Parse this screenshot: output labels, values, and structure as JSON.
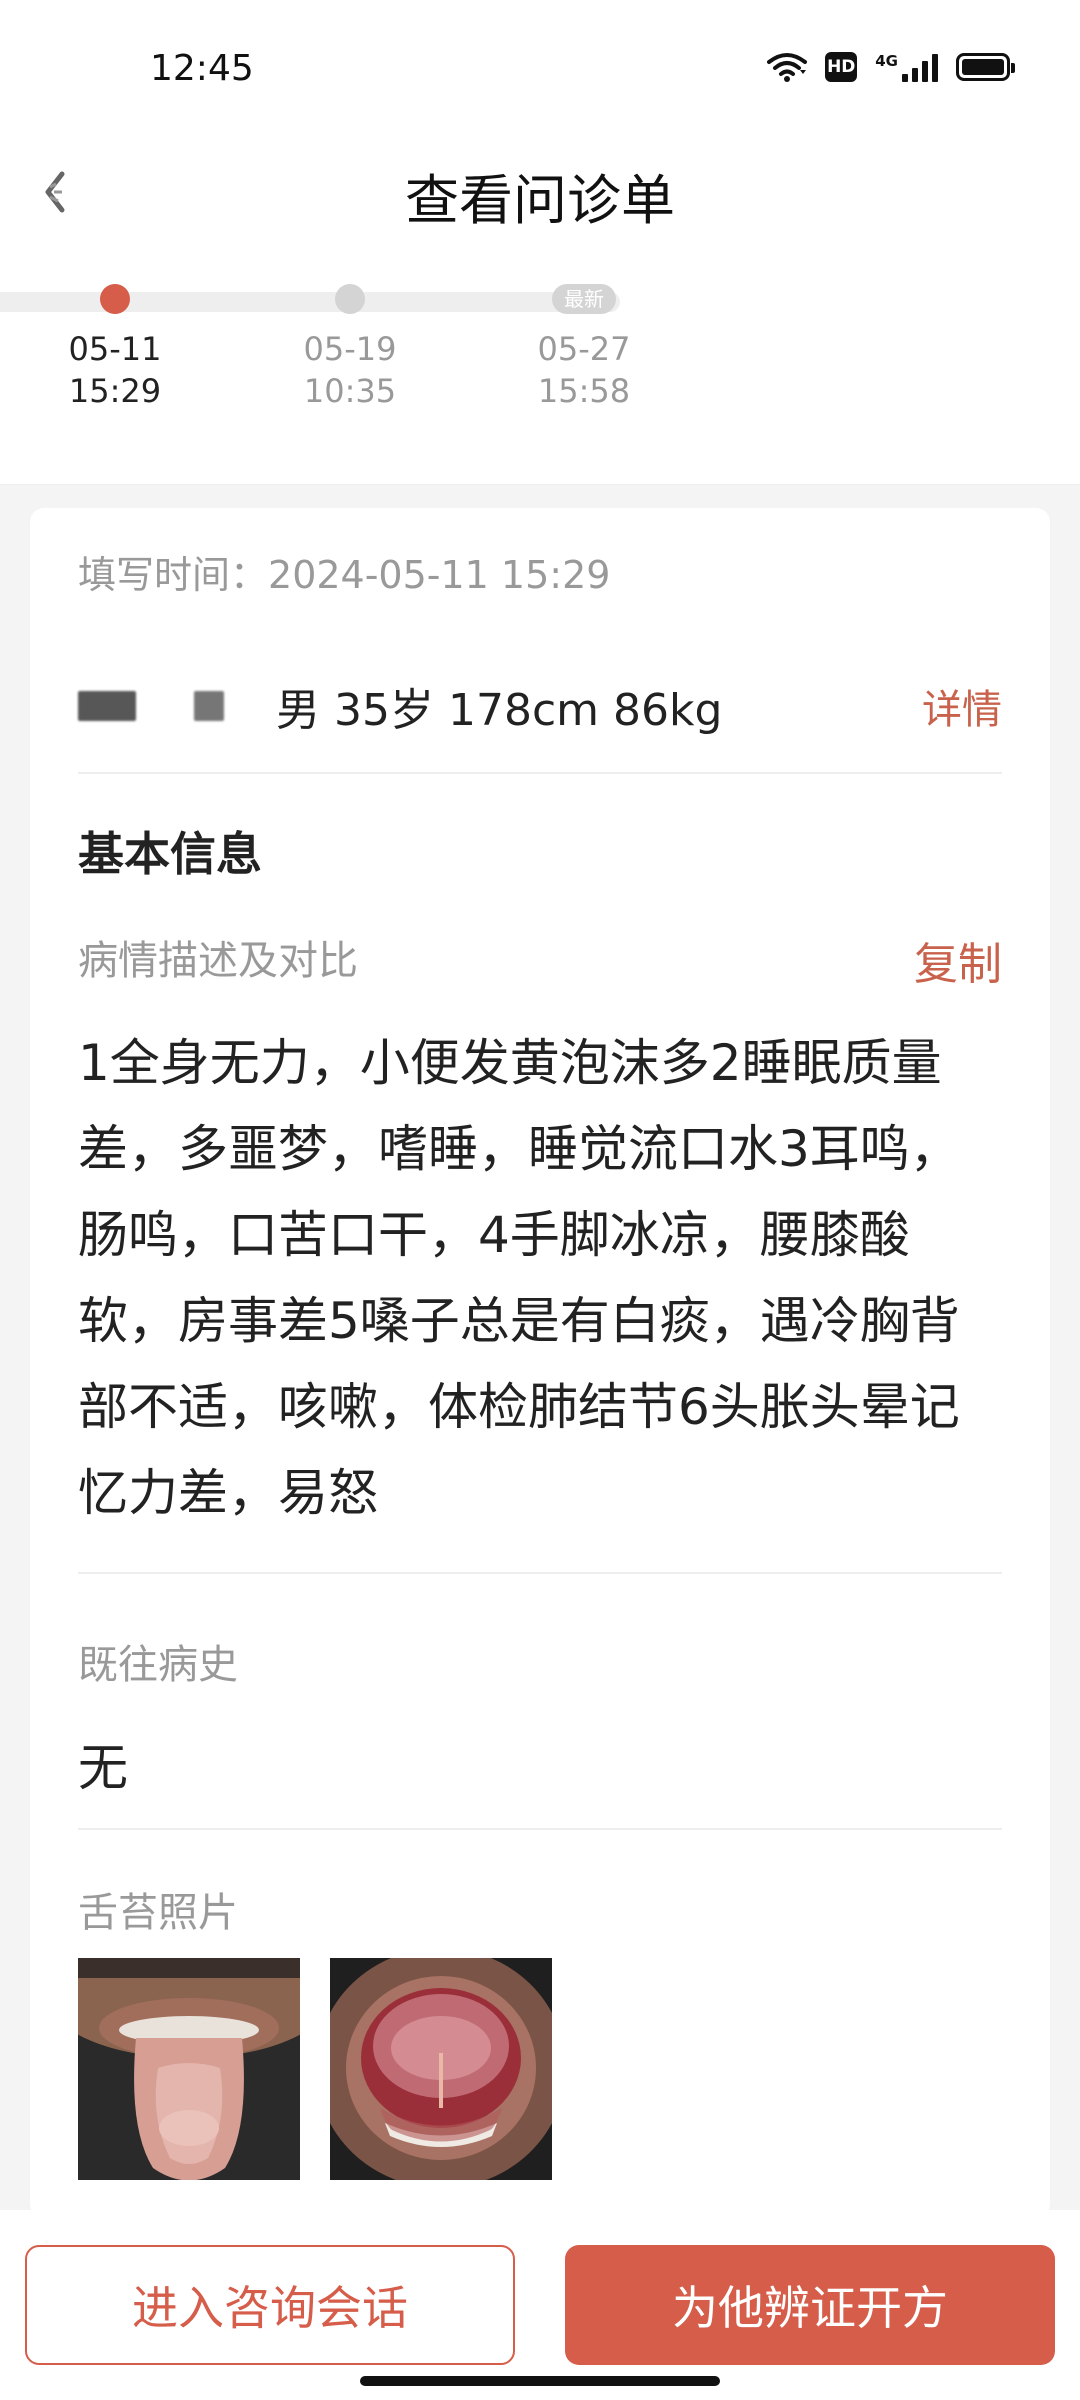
{
  "status_bar": {
    "time": "12:45",
    "hd": "HD",
    "signal_label": "4G"
  },
  "header": {
    "title": "查看问诊单"
  },
  "timeline": {
    "items": [
      {
        "date": "05-11",
        "time": "15:29",
        "active": true
      },
      {
        "date": "05-19",
        "time": "10:35",
        "active": false
      },
      {
        "date": "05-27",
        "time": "15:58",
        "active": false,
        "badge": "最新"
      }
    ]
  },
  "card": {
    "fill_time_label": "填写时间：",
    "fill_time_value": "2024-05-11 15:29",
    "patient_info": "男 35岁 178cm 86kg",
    "detail_link": "详情",
    "basic_info_title": "基本信息",
    "condition_label": "病情描述及对比",
    "copy_link": "复制",
    "condition_text": "1全身无力，小便发黄泡沫多2睡眠质量差，多噩梦，嗜睡，睡觉流口水3耳鸣，肠鸣，口苦口干，4手脚冰凉，腰膝酸软，房事差5嗓子总是有白痰，遇冷胸背部不适，咳嗽，体检肺结节6头胀头晕记忆力差，易怒",
    "history_label": "既往病史",
    "history_value": "无",
    "tongue_label": "舌苔照片"
  },
  "bottom": {
    "consult_button": "进入咨询会话",
    "prescribe_button": "为他辨证开方"
  },
  "colors": {
    "accent": "#d55d4a",
    "accent_text": "#c9624c",
    "muted": "#999999"
  },
  "icons": [
    "back-arrow-icon",
    "wifi-icon",
    "hd-icon",
    "signal-icon",
    "battery-icon"
  ]
}
